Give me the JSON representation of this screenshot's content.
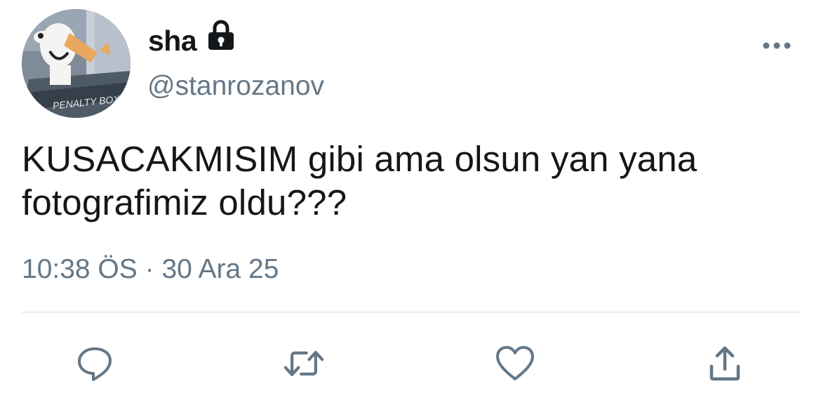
{
  "user": {
    "display_name": "sha",
    "handle": "@stanrozanov",
    "protected": true,
    "avatar_caption": "PENALTY BOX"
  },
  "tweet": {
    "text": "KUSACAKMISIM gibi ama olsun yan yana fotografimiz oldu???",
    "time": "10:38 ÖS",
    "separator": "·",
    "date": "30 Ara 25"
  },
  "icons": {
    "lock": "lock-icon",
    "more": "more-icon",
    "reply": "reply-icon",
    "retweet": "retweet-icon",
    "like": "heart-icon",
    "share": "share-icon"
  },
  "colors": {
    "text": "#14171a",
    "secondary": "#657786",
    "action_icon": "#657786",
    "divider": "#e6ecf0"
  }
}
